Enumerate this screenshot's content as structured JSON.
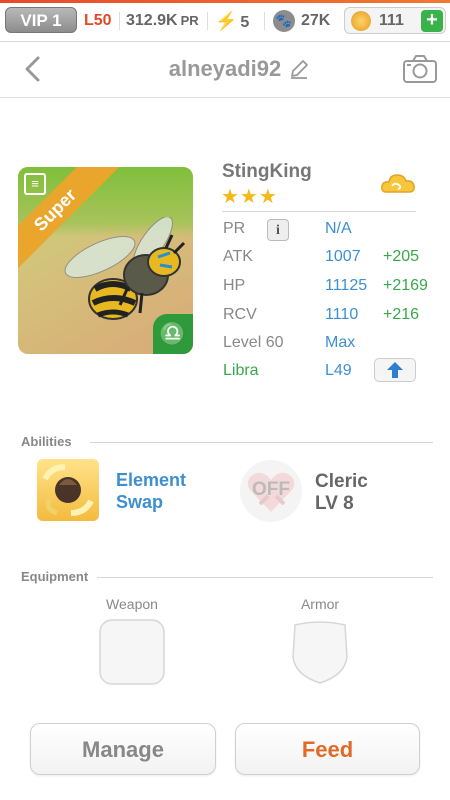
{
  "statusbar": {
    "vip_label": "VIP 1",
    "level": "L50",
    "pr_value": "312.9K",
    "pr_unit": "PR",
    "energy": "5",
    "paw_count": "27K",
    "coins": "111",
    "add_label": "+"
  },
  "header": {
    "title": "alneyadi92"
  },
  "monster": {
    "badge": "Super",
    "name": "StingKing",
    "stars": "★★★",
    "stats": [
      {
        "label": "PR",
        "value": "N/A",
        "bonus": ""
      },
      {
        "label": "ATK",
        "value": "1007",
        "bonus": "+205"
      },
      {
        "label": "HP",
        "value": "11125",
        "bonus": "+2169"
      },
      {
        "label": "RCV",
        "value": "1110",
        "bonus": "+216"
      },
      {
        "label": "Level 60",
        "value": "Max",
        "bonus": ""
      },
      {
        "label": "Libra",
        "value": "L49",
        "bonus": ""
      }
    ],
    "info_button": "i",
    "zodiac_symbol": "♎"
  },
  "abilities": {
    "title": "Abilities",
    "ability_line1": "Element",
    "ability_line2": "Swap",
    "off_label": "OFF",
    "class_name": "Cleric",
    "class_level": "LV 8"
  },
  "equipment": {
    "title": "Equipment",
    "weapon_label": "Weapon",
    "armor_label": "Armor"
  },
  "actions": {
    "manage_label": "Manage",
    "feed_label": "Feed"
  },
  "colors": {
    "accent_blue": "#3e8fd0",
    "bonus_green": "#3aa84a",
    "feed_orange": "#e06a26",
    "level_red": "#e04a24"
  }
}
